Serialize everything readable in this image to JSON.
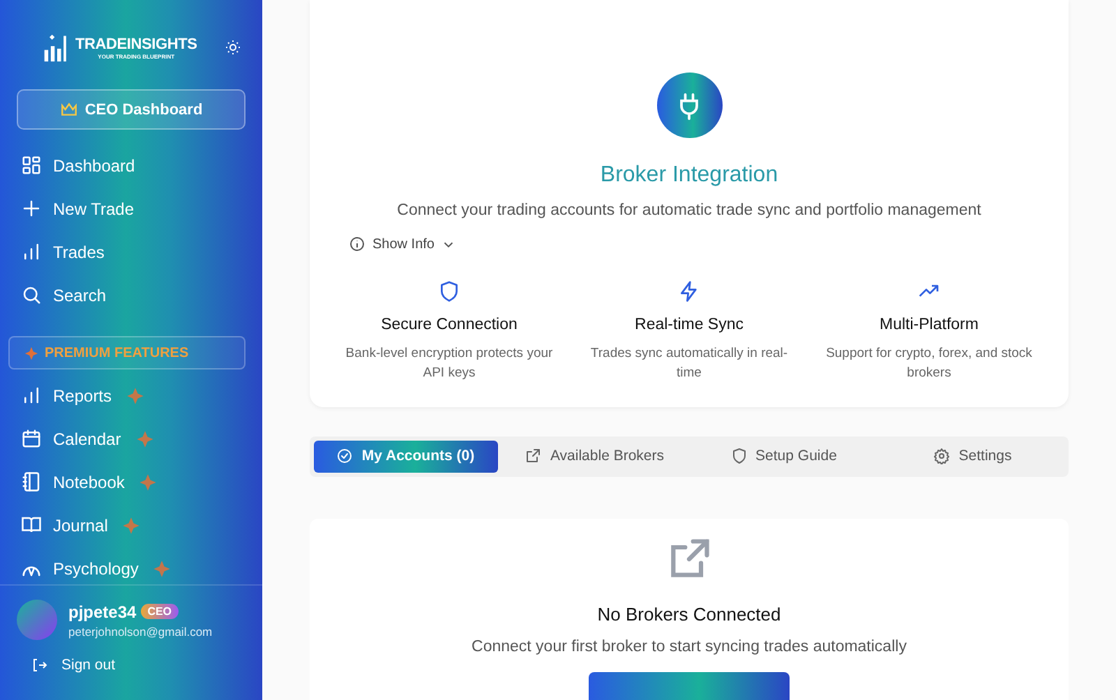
{
  "brand": {
    "name": "TRADEINSIGHTS",
    "tagline": "YOUR TRADING BLUEPRINT"
  },
  "ceo_button": "CEO Dashboard",
  "nav": [
    {
      "label": "Dashboard"
    },
    {
      "label": "New Trade"
    },
    {
      "label": "Trades"
    },
    {
      "label": "Search"
    }
  ],
  "premium_header": "PREMIUM FEATURES",
  "premium_nav": [
    {
      "label": "Reports",
      "premium": true
    },
    {
      "label": "Calendar",
      "premium": true
    },
    {
      "label": "Notebook",
      "premium": true
    },
    {
      "label": "Journal",
      "premium": true
    },
    {
      "label": "Psychology",
      "premium": true
    }
  ],
  "user": {
    "name": "pjpete34",
    "badge": "CEO",
    "email": "peterjohnolson@gmail.com"
  },
  "sign_out": "Sign out",
  "hero": {
    "title": "Broker Integration",
    "subtitle": "Connect your trading accounts for automatic trade sync and portfolio management",
    "show_info": "Show Info",
    "features": [
      {
        "title": "Secure Connection",
        "text": "Bank-level encryption protects your API keys"
      },
      {
        "title": "Real-time Sync",
        "text": "Trades sync automatically in real-time"
      },
      {
        "title": "Multi-Platform",
        "text": "Support for crypto, forex, and stock brokers"
      }
    ]
  },
  "tabs": [
    {
      "label": "My Accounts (0)",
      "selected": true
    },
    {
      "label": "Available Brokers",
      "selected": false
    },
    {
      "label": "Setup Guide",
      "selected": false
    },
    {
      "label": "Settings",
      "selected": false
    }
  ],
  "empty": {
    "title": "No Brokers Connected",
    "text": "Connect your first broker to start syncing trades automatically"
  }
}
